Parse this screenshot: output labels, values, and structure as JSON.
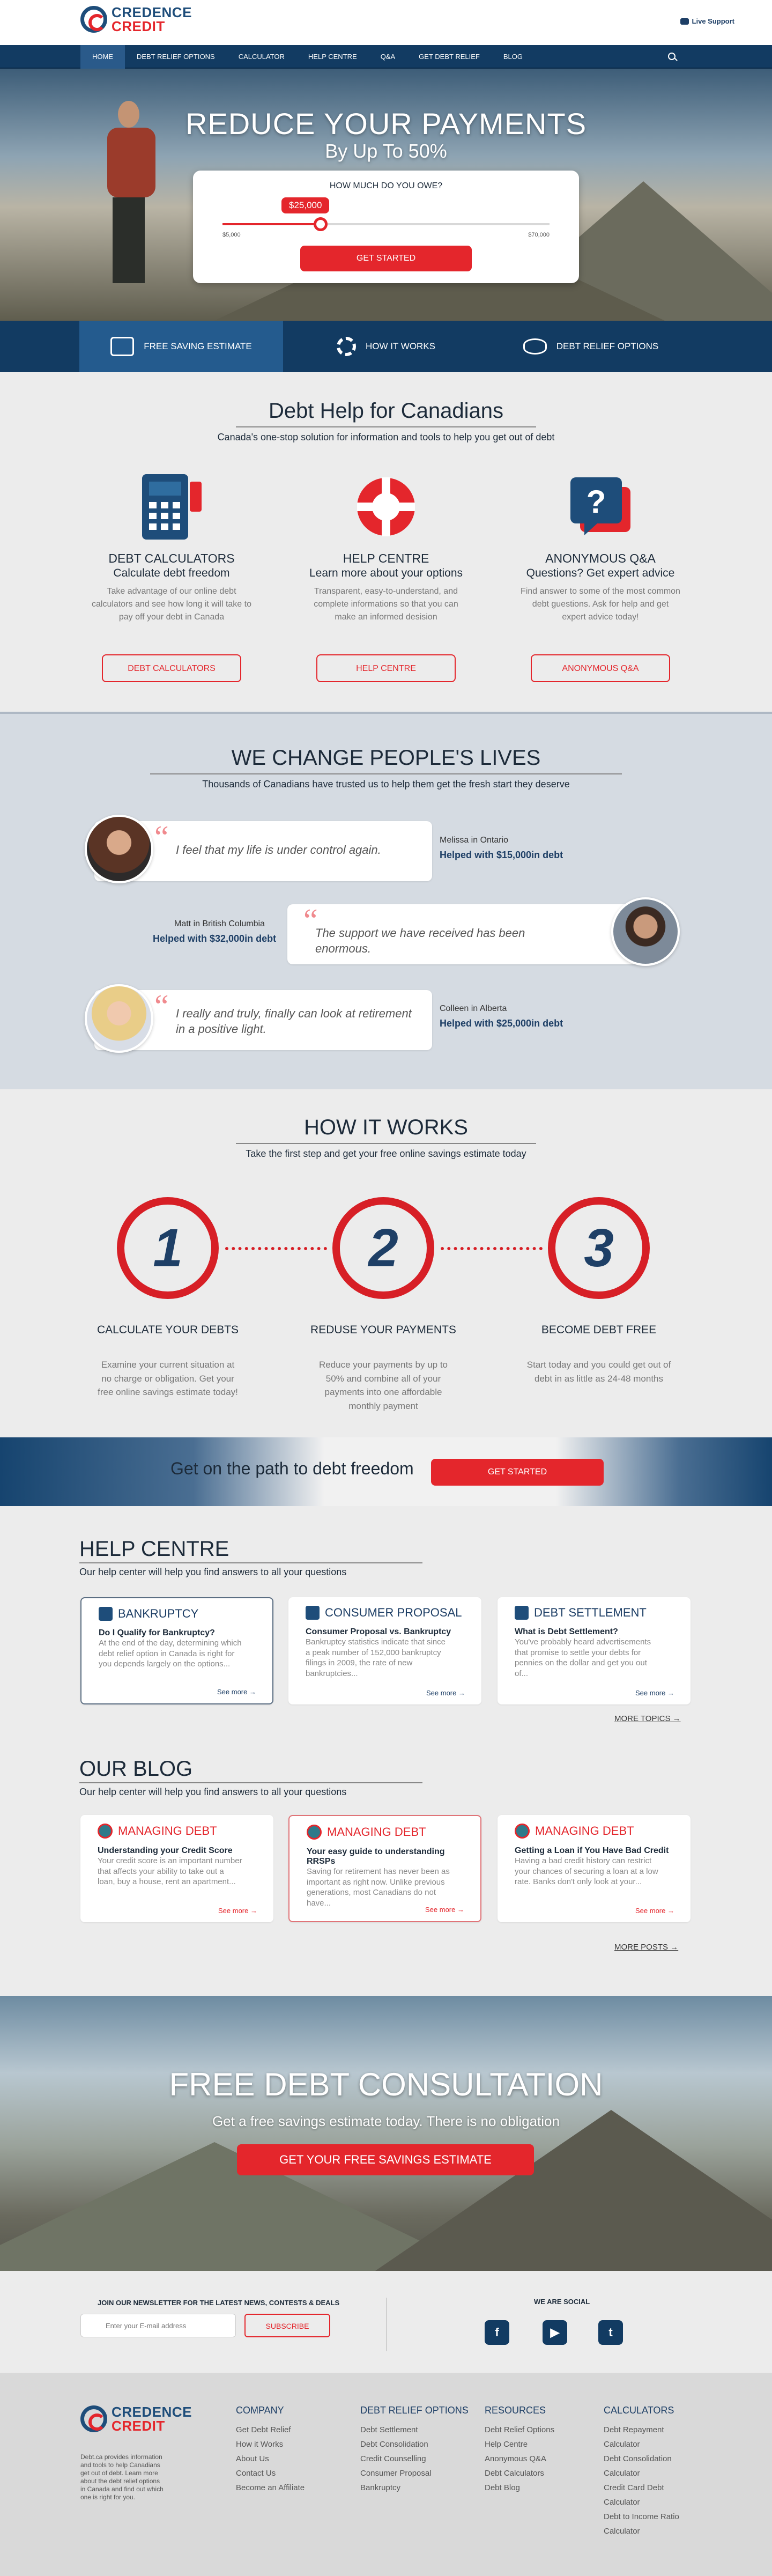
{
  "brand": {
    "line1": "CREDENCE",
    "line2": "CREDIT"
  },
  "support": "Live Support",
  "nav": [
    "HOME",
    "DEBT RELIEF OPTIONS",
    "CALCULATOR",
    "HELP CENTRE",
    "Q&A",
    "GET DEBT RELIEF",
    "BLOG"
  ],
  "hero": {
    "title": "REDUCE YOUR PAYMENTS",
    "subtitle": "By Up To 50%",
    "question": "HOW MUCH DO YOU OWE?",
    "amount": "$25,000",
    "min": "$5,000",
    "max": "$70,000",
    "level": 0.3,
    "button": "GET STARTED"
  },
  "tabs": [
    "FREE SAVING ESTIMATE",
    "HOW IT WORKS",
    "DEBT RELIEF OPTIONS"
  ],
  "debt_help": {
    "title": "Debt Help for Canadians",
    "subtitle": "Canada's one-stop solution for information and tools to help you get out of debt",
    "cards": [
      {
        "title": "DEBT CALCULATORS",
        "sub": "Calculate debt freedom",
        "text": "Take advantage of our online debt calculators and see how long it will take to pay off your debt in Canada",
        "button": "DEBT CALCULATORS"
      },
      {
        "title": "HELP CENTRE",
        "sub": "Learn more about your options",
        "text": "Transparent, easy-to-understand, and complete informations so that you can make an informed desision",
        "button": "HELP CENTRE"
      },
      {
        "title": "ANONYMOUS Q&A",
        "sub": "Questions? Get expert advice",
        "text": "Find answer to some of the most common debt guestions. Ask for help and get expert advice today!",
        "button": "ANONYMOUS Q&A"
      }
    ]
  },
  "lives": {
    "title": "WE CHANGE PEOPLE'S LIVES",
    "subtitle": "Thousands of Canadians have trusted us to help them get the fresh start they deserve",
    "items": [
      {
        "quote": "I feel that my life is under control again.",
        "who": "Melissa in Ontario",
        "amount": "Helped with $15,000in debt"
      },
      {
        "quote": "The support we have received has been enormous.",
        "who": "Matt in British Columbia",
        "amount": "Helped with $32,000in debt"
      },
      {
        "quote": "I really and truly, finally can look at retirement in a positive light.",
        "who": "Colleen in Alberta",
        "amount": "Helped with $25,000in debt"
      }
    ]
  },
  "how": {
    "title": "HOW IT WORKS",
    "subtitle": "Take the first step and get your free online savings estimate today",
    "steps": [
      {
        "n": "1",
        "title": "CALCULATE YOUR DEBTS",
        "text": "Examine your current situation at no charge or obligation. Get your free online savings estimate today!"
      },
      {
        "n": "2",
        "title": "REDUSE YOUR PAYMENTS",
        "text": "Reduce your payments by up to 50% and combine all of your payments into one affordable monthly payment"
      },
      {
        "n": "3",
        "title": "BECOME DEBT FREE",
        "text": "Start today and you could get out of debt in as little as 24-48 months"
      }
    ]
  },
  "cta": {
    "text": "Get on the path to debt freedom",
    "button": "GET STARTED"
  },
  "help_centre": {
    "title": "HELP CENTRE",
    "subtitle": "Our help center will help you find answers to all your questions",
    "more": "MORE TOPICS",
    "cards": [
      {
        "cat": "BANKRUPTCY",
        "q": "Do I Qualify for Bankruptcy?",
        "ex": "At the end of the day, determining which debt relief option in Canada is right for you depends largely on the options...",
        "see": "See more"
      },
      {
        "cat": "CONSUMER PROPOSAL",
        "q": "Consumer Proposal vs. Bankruptcy",
        "ex": "Bankruptcy statistics indicate that since a peak number of 152,000 bankruptcy filings in 2009, the rate of new bankruptcies...",
        "see": "See more"
      },
      {
        "cat": "DEBT SETTLEMENT",
        "q": "What is Debt Settlement?",
        "ex": "You've probably heard advertisements that promise to settle your debts for pennies on the dollar and get you out of...",
        "see": "See more"
      }
    ]
  },
  "blog": {
    "title": "OUR BLOG",
    "subtitle": "Our help center will help you find answers to all your questions",
    "more": "MORE POSTS",
    "cards": [
      {
        "cat": "MANAGING DEBT",
        "q": "Understanding your Credit Score",
        "ex": "Your credit score is an important number that affects your ability to take out a loan, buy a house, rent an apartment...",
        "see": "See more"
      },
      {
        "cat": "MANAGING DEBT",
        "q": "Your easy guide to understanding RRSPs",
        "ex": "Saving for retirement has never been as important as right now. Unlike previous generations, most Canadians do not have...",
        "see": "See more"
      },
      {
        "cat": "MANAGING DEBT",
        "q": "Getting a Loan if You Have Bad Credit",
        "ex": "Having a bad credit history can restrict your chances of securing a loan at a low rate. Banks don't only look at your...",
        "see": "See more"
      }
    ]
  },
  "consult": {
    "title": "FREE DEBT CONSULTATION",
    "subtitle": "Get a free savings estimate today. There is no obligation",
    "button": "GET YOUR FREE SAVINGS ESTIMATE"
  },
  "newsletter": {
    "label": "JOIN OUR NEWSLETTER FOR THE LATEST NEWS, CONTESTS & DEALS",
    "placeholder": "Enter your E-mail address",
    "button": "SUBSCRIBE",
    "social": "WE ARE SOCIAL"
  },
  "footer": {
    "blurb": "Debt.ca provides information and tools to help Canadians get out of debt. Learn more about the debt relief options in Canada and find out which one is right for you.",
    "cols": [
      {
        "h": "COMPANY",
        "items": [
          "Get Debt Relief",
          "How it Works",
          "About Us",
          "Contact Us",
          "Become an Affiliate"
        ]
      },
      {
        "h": "DEBT RELIEF OPTIONS",
        "items": [
          "Debt Settlement",
          "Debt Consolidation",
          "Credit Counselling",
          "Consumer Proposal",
          "Bankruptcy"
        ]
      },
      {
        "h": "RESOURCES",
        "items": [
          "Debt Relief Options",
          "Help Centre",
          "Anonymous Q&A",
          "Debt Calculators",
          "Debt Blog"
        ]
      },
      {
        "h": "CALCULATORS",
        "items": [
          "Debt Repayment Calculator",
          "Debt Consolidation Calculator",
          "Credit Card Debt Calculator",
          "Debt to Income Ratio Calculator"
        ]
      }
    ]
  }
}
